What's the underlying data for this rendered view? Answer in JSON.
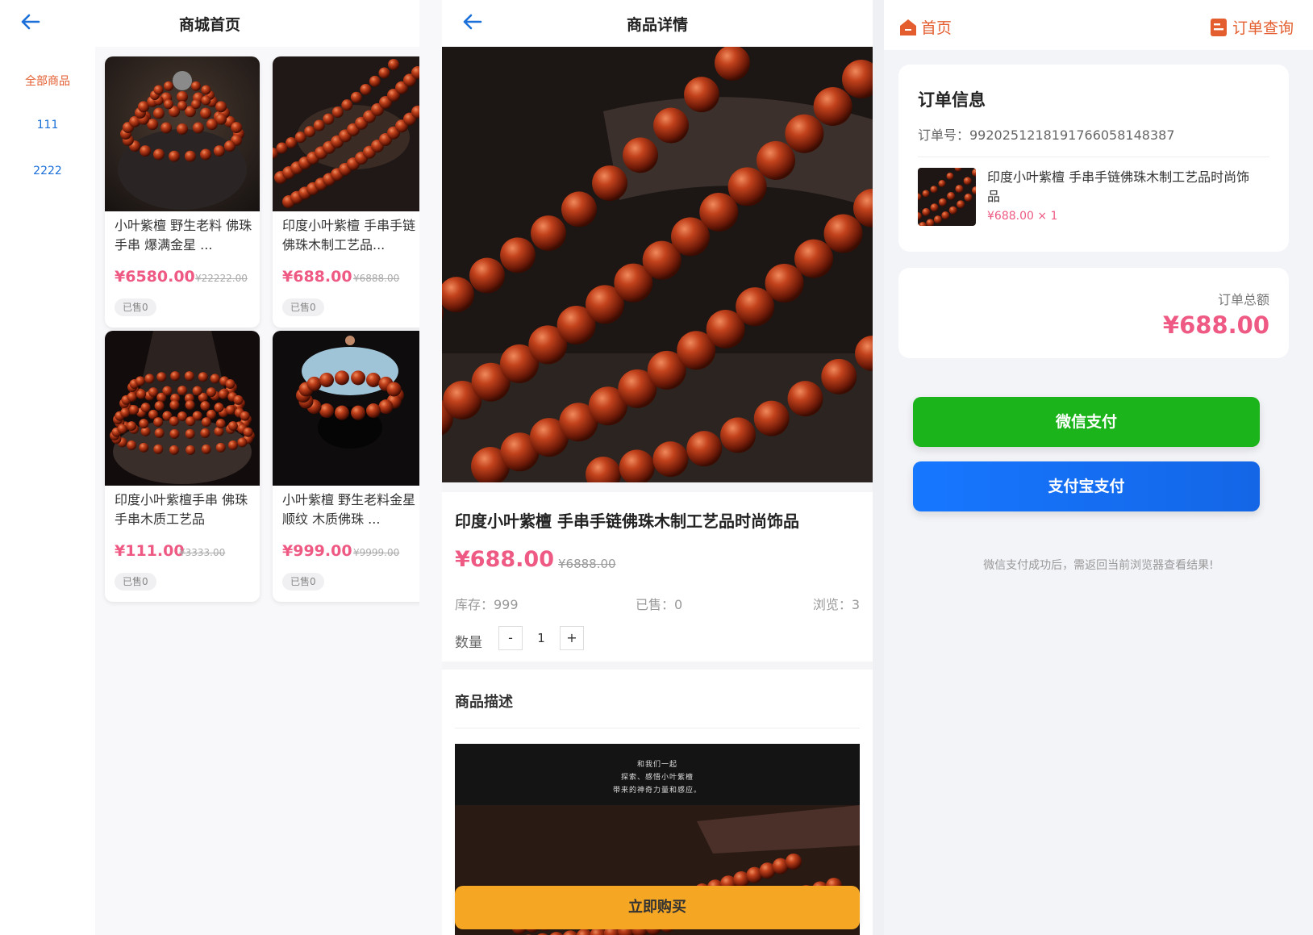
{
  "shop": {
    "title": "商城首页",
    "categories": [
      "全部商品",
      "111",
      "2222"
    ],
    "products": [
      {
        "name": "小叶紫檀 野生老料 佛珠 手串 爆满金星 ...",
        "price": "¥6580.00",
        "original_price": "¥22222.00",
        "sold": "已售0"
      },
      {
        "name": "印度小叶紫檀 手串手链佛珠木制工艺品...",
        "price": "¥688.00",
        "original_price": "¥6888.00",
        "sold": "已售0"
      },
      {
        "name": "印度小叶紫檀手串 佛珠手串木质工艺品",
        "price": "¥111.00",
        "original_price": "¥3333.00",
        "sold": "已售0"
      },
      {
        "name": "小叶紫檀 野生老料金星 顺纹 木质佛珠 ...",
        "price": "¥999.00",
        "original_price": "¥9999.00",
        "sold": "已售0"
      }
    ]
  },
  "detail": {
    "title": "商品详情",
    "product_name": "印度小叶紫檀 手串手链佛珠木制工艺品时尚饰品",
    "price": "¥688.00",
    "original_price": "¥6888.00",
    "stock": "库存：999",
    "sold": "已售：0",
    "views": "浏览：3",
    "qty_label": "数量",
    "qty_minus": "-",
    "qty_value": "1",
    "qty_plus": "+",
    "desc_title": "商品描述",
    "desc_lines": [
      "和我们一起",
      "探索、感悟小叶紫檀",
      "带来的神奇力量和感应。"
    ],
    "buy_label": "立即购买"
  },
  "order": {
    "home_label": "首页",
    "orders_label": "订单查询",
    "info_title": "订单信息",
    "order_no": "订单号：9920251218191766058148387",
    "item_name": "印度小叶紫檀 手串手链佛珠木制工艺品时尚饰品",
    "item_price": "¥688.00 × 1",
    "total_label": "订单总额",
    "total_value": "¥688.00",
    "wechat_pay": "微信支付",
    "alipay": "支付宝支付",
    "note": "微信支付成功后，需返回当前浏览器查看结果!"
  },
  "colors": {
    "accent": "#e35d2f",
    "price": "#ee5a83",
    "link": "#1a6fd8",
    "buy": "#f5a623",
    "wechat": "#1bb41b",
    "alipay": "#1677ff"
  },
  "icons": [
    "back-arrow-icon",
    "home-icon",
    "order-list-icon"
  ]
}
